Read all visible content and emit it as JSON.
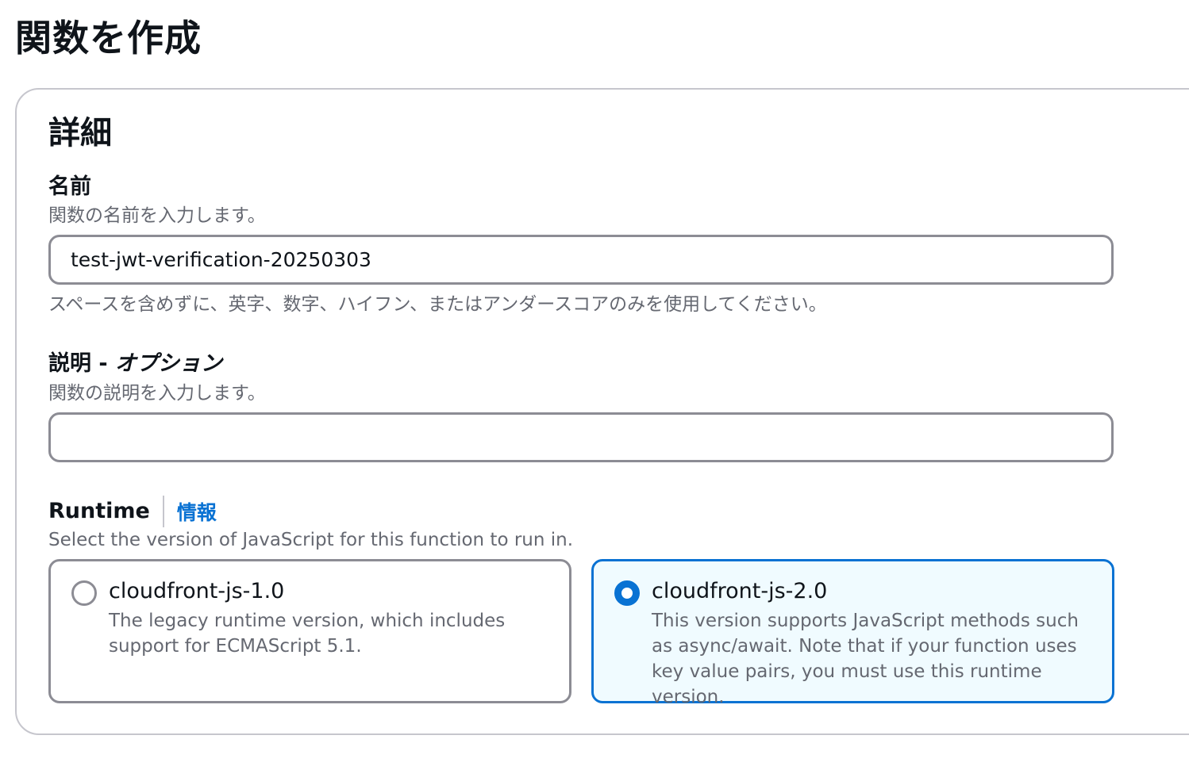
{
  "page": {
    "title": "関数を作成"
  },
  "details": {
    "title": "詳細",
    "name": {
      "label": "名前",
      "description": "関数の名前を入力します。",
      "value": "test-jwt-verification-20250303",
      "constraint": "スペースを含めずに、英字、数字、ハイフン、またはアンダースコアのみを使用してください。"
    },
    "description": {
      "label": "説明 - ",
      "label_optional": "オプション",
      "description": "関数の説明を入力します。",
      "value": ""
    },
    "runtime": {
      "label": "Runtime",
      "info_link": "情報",
      "description": "Select the version of JavaScript for this function to run in.",
      "options": [
        {
          "title": "cloudfront-js-1.0",
          "description": "The legacy runtime version, which includes support for ECMAScript 5.1.",
          "selected": false
        },
        {
          "title": "cloudfront-js-2.0",
          "description": "This version supports JavaScript methods such as async/await. Note that if your function uses key value pairs, you must use this runtime version.",
          "selected": true
        }
      ]
    }
  },
  "colors": {
    "accent": "#0972d3",
    "selected_background": "#f0fbff",
    "border": "#8c8c94",
    "muted_text": "#656871"
  }
}
